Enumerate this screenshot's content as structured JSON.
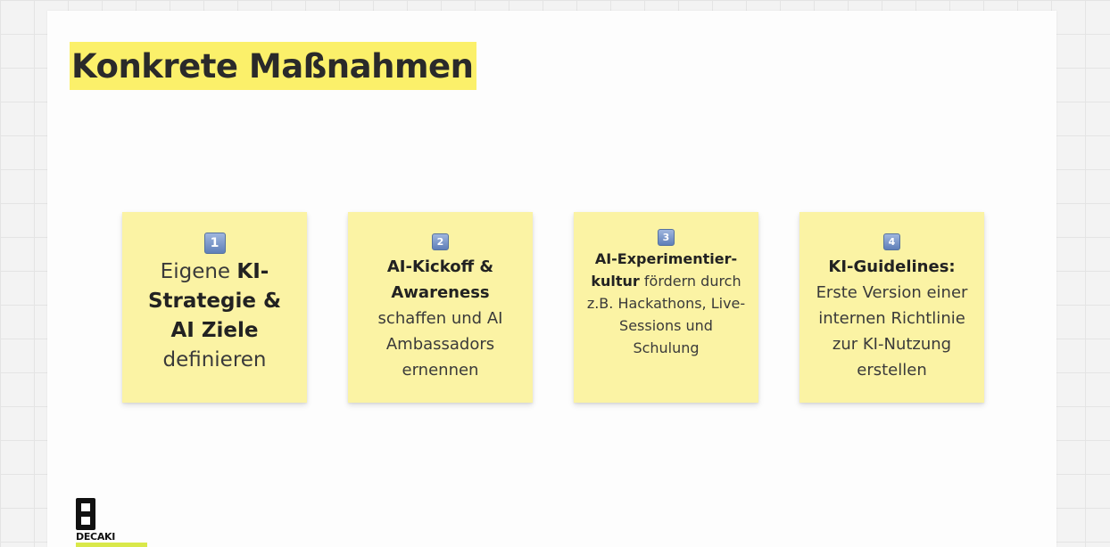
{
  "slide": {
    "title": "Konkrete Maßnahmen"
  },
  "notes": [
    {
      "badge": "1",
      "parts": [
        {
          "text": "Eigene ",
          "bold": false
        },
        {
          "text": "KI-Strategie & AI Ziele",
          "bold": true
        },
        {
          "text": " definieren",
          "bold": false
        }
      ]
    },
    {
      "badge": "2",
      "parts": [
        {
          "text": "AI-Kickoff & Awareness",
          "bold": true
        },
        {
          "text": " schaffen und AI Ambassadors ernennen",
          "bold": false
        }
      ]
    },
    {
      "badge": "3",
      "parts": [
        {
          "text": "AI-Experimentier-kultur",
          "bold": true
        },
        {
          "text": " fördern durch z.B. Hackathons, Live-Sessions und Schulung",
          "bold": false
        }
      ]
    },
    {
      "badge": "4",
      "parts": [
        {
          "text": "KI-Guidelines:",
          "bold": true
        },
        {
          "text": " Erste Version einer internen Richtlinie zur KI-Nutzung erstellen",
          "bold": false
        }
      ]
    }
  ],
  "logo": {
    "text": "DECAKI"
  },
  "colors": {
    "title_highlight": "#fbf06a",
    "sticky_note": "#fbf3a4",
    "badge": "#6f8cc2"
  }
}
